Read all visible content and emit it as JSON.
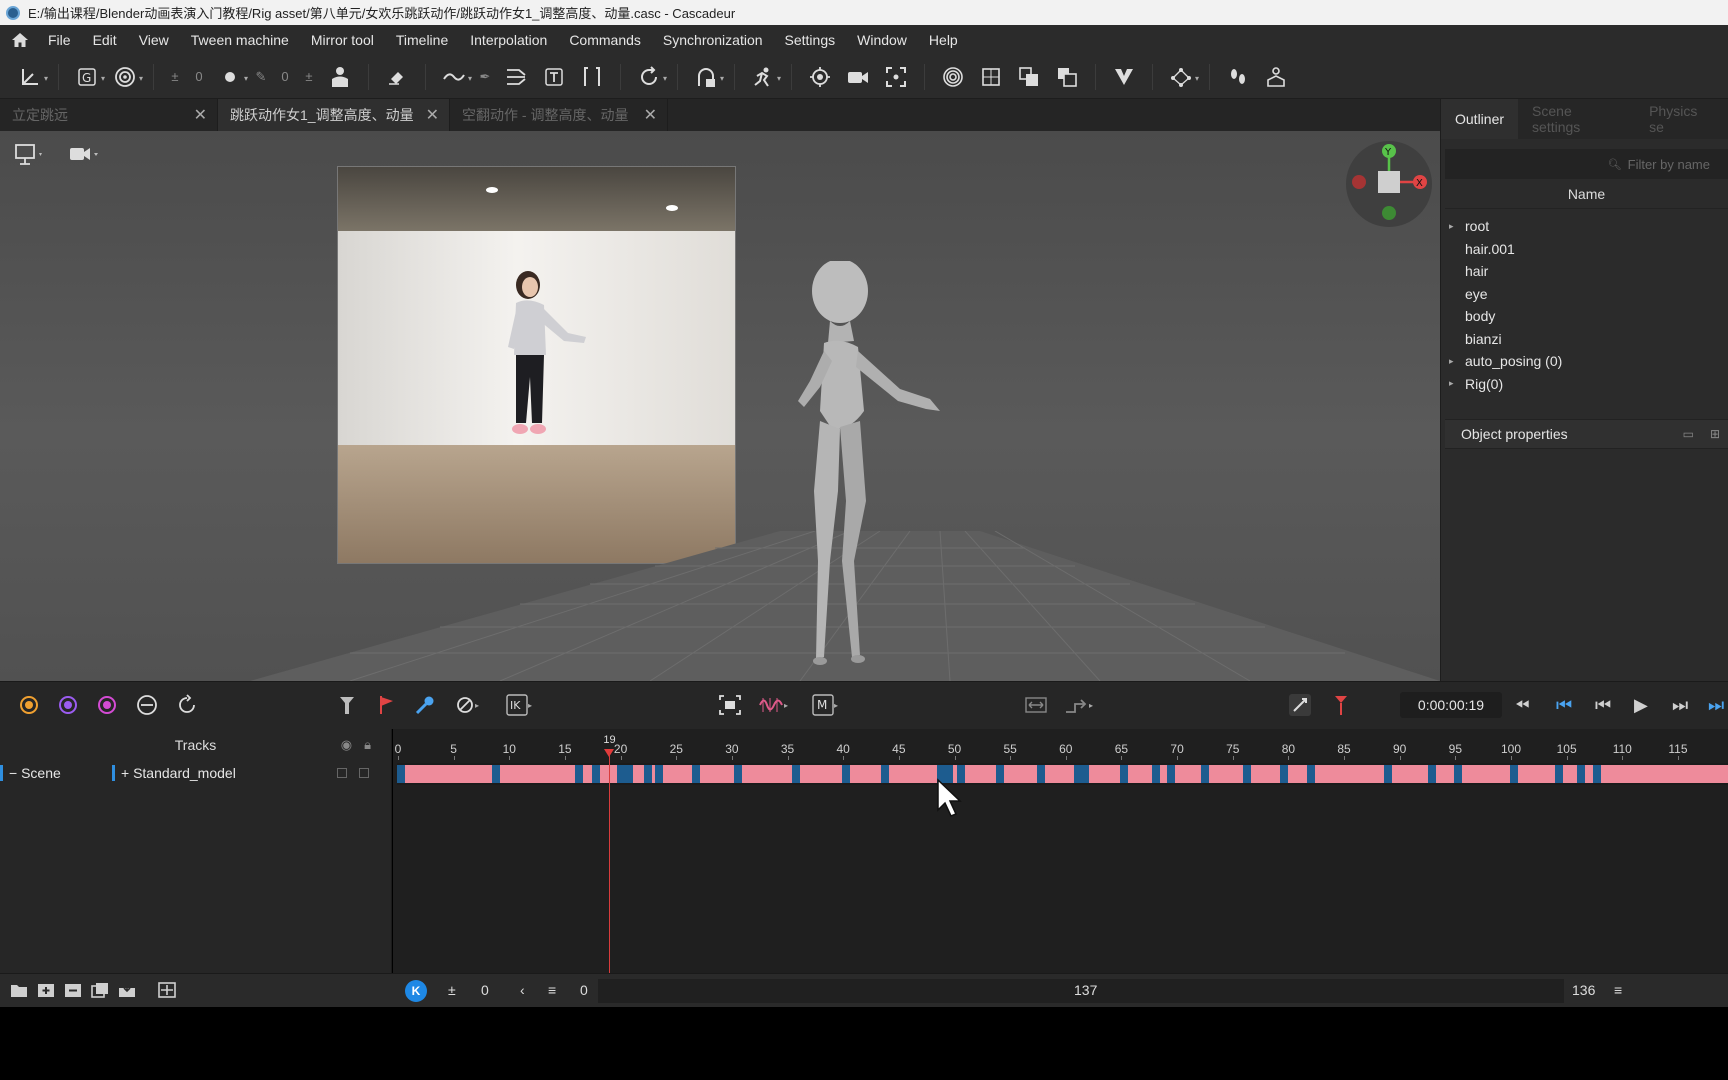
{
  "window": {
    "title": "E:/输出课程/Blender动画表演入门教程/Rig asset/第八单元/女欢乐跳跃动作/跳跃动作女1_调整高度、动量.casc - Cascadeur"
  },
  "menu": [
    "File",
    "Edit",
    "View",
    "Tween machine",
    "Mirror tool",
    "Timeline",
    "Interpolation",
    "Commands",
    "Synchronization",
    "Settings",
    "Window",
    "Help"
  ],
  "toolbar": {
    "counter_a": "0",
    "counter_b": "0"
  },
  "tabs": [
    {
      "label": "立定跳远"
    },
    {
      "label": "跳跃动作女1_调整高度、动量"
    },
    {
      "label": "空翻动作 - 调整高度、动量"
    }
  ],
  "gizmo": {
    "y": "Y",
    "x": "X"
  },
  "right_panel": {
    "tabs": [
      "Outliner",
      "Scene settings",
      "Physics se"
    ],
    "filter_placeholder": "Filter by name",
    "column_header": "Name",
    "tree": [
      {
        "label": "root",
        "expandable": true
      },
      {
        "label": "hair.001",
        "expandable": false
      },
      {
        "label": "hair",
        "expandable": false
      },
      {
        "label": "eye",
        "expandable": false
      },
      {
        "label": "body",
        "expandable": false
      },
      {
        "label": "bianzi",
        "expandable": false
      },
      {
        "label": "auto_posing (0)",
        "expandable": true
      },
      {
        "label": "Rig(0)",
        "expandable": true
      }
    ],
    "object_properties": "Object properties"
  },
  "timeline": {
    "time_display": "0:00:00:19",
    "tracks_header": "Tracks",
    "scene_label": "Scene",
    "model_label": "Standard_model",
    "current_frame": "19",
    "ruler_labels": [
      "0",
      "5",
      "10",
      "15",
      "20",
      "25",
      "30",
      "35",
      "40",
      "45",
      "50",
      "55",
      "60",
      "65",
      "70",
      "75",
      "80",
      "85",
      "90",
      "95",
      "100",
      "105",
      "110",
      "115"
    ],
    "start_frame": "0",
    "range_start": "0",
    "total_frames": "137",
    "end_frame": "136",
    "k_button": "K"
  },
  "colors": {
    "accent": "#1e88e5",
    "keyframe_pink": "#ee8b9b",
    "keyframe_blue": "#1d5c8f",
    "playhead": "#e23b3b"
  }
}
